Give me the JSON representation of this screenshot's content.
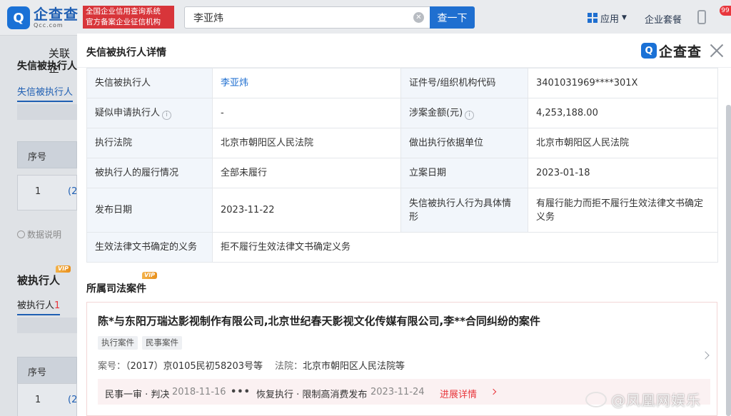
{
  "header": {
    "logo_cn": "企查查",
    "logo_en": "Qcc.com",
    "slogan_line1": "全国企业信用查询系统",
    "slogan_line2": "官方备案企业征信机构",
    "search_value": "李亚炜",
    "search_button": "查一下",
    "apps_label": "应用",
    "enterprise_label": "企业套餐",
    "badge_count": "99"
  },
  "background_page": {
    "tab": "关联企",
    "section1": "失信被执行人",
    "sub1": "失信被执行人",
    "col_seq": "序号",
    "row1_seq": "1",
    "row1_link": "(2",
    "note": "数据说明",
    "section2": "被执行人",
    "vip": "VIP",
    "sub2": "被执行人",
    "sub2_count": "1",
    "col_seq2": "序号",
    "row2_seq": "1",
    "row2_link": "(2"
  },
  "modal": {
    "title": "失信被执行人详情",
    "logo_text": "企查查",
    "detail": {
      "dishonest_person_label": "失信被执行人",
      "dishonest_person_value": "李亚炜",
      "id_label": "证件号/组织机构代码",
      "id_value": "3401031969****301X",
      "applicant_label": "疑似申请执行人",
      "applicant_value": "-",
      "amount_label": "涉案金额(元)",
      "amount_value": "4,253,188.00",
      "court_label": "执行法院",
      "court_value": "北京市朝阳区人民法院",
      "basis_unit_label": "做出执行依据单位",
      "basis_unit_value": "北京市朝阳区人民法院",
      "performance_label": "被执行人的履行情况",
      "performance_value": "全部未履行",
      "filing_date_label": "立案日期",
      "filing_date_value": "2023-01-18",
      "publish_date_label": "发布日期",
      "publish_date_value": "2023-11-22",
      "behavior_label": "失信被执行人行为具体情形",
      "behavior_value": "有履行能力而拒不履行生效法律文书确定义务",
      "obligation_label": "生效法律文书确定的义务",
      "obligation_value": "拒不履行生效法律文书确定义务"
    },
    "cases_title": "所属司法案件",
    "cases_vip": "VIP",
    "case": {
      "title": "陈*与东阳万瑞达影视制作有限公司,北京世纪春天影视文化传媒有限公司,李**合同纠纷的案件",
      "tag1": "执行案件",
      "tag2": "民事案件",
      "case_no_label": "案号：",
      "case_no_value": "（2017）京0105民初58203号等",
      "court_label": "法院：",
      "court_value": "北京市朝阳区人民法院等",
      "progress1_label": "民事一审 · 判决",
      "progress1_date": "2018-11-16",
      "progress_more": "•••",
      "progress2_label": "恢复执行 · 限制高消费发布",
      "progress2_date": "2023-11-24",
      "progress_link": "进展详情"
    }
  },
  "watermark": "@凤凰网娱乐"
}
